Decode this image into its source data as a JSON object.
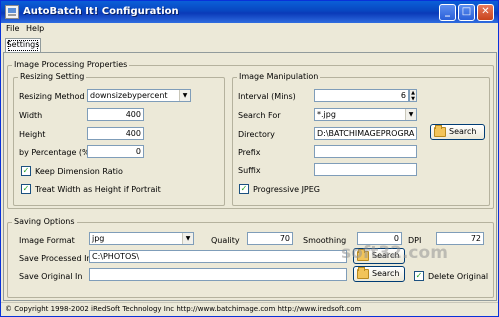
{
  "window": {
    "title": "AutoBatch It! Configuration",
    "minimize": "_",
    "maximize": "□",
    "close": "✕"
  },
  "menu": {
    "file": "File",
    "help": "Help"
  },
  "tab": {
    "settings": "Settings"
  },
  "image_processing": {
    "title": "Image Processing Properties",
    "resizing": {
      "title": "Resizing Setting",
      "method_label": "Resizing Method",
      "method_value": "downsizebypercent",
      "width_label": "Width",
      "width_value": "400",
      "height_label": "Height",
      "height_value": "400",
      "percentage_label": "by Percentage (%)",
      "percentage_value": "0",
      "keep_ratio_label": "Keep Dimension Ratio",
      "keep_ratio_checked": true,
      "treat_width_label": "Treat Width as Height if Portrait",
      "treat_width_checked": true
    },
    "manipulation": {
      "title": "Image Manipulation",
      "interval_label": "Interval (Mins)",
      "interval_value": "6",
      "search_for_label": "Search For",
      "search_for_value": "*.jpg",
      "directory_label": "Directory",
      "directory_value": "D:\\BATCHIMAGEPROGRA",
      "search_button": "Search",
      "prefix_label": "Prefix",
      "prefix_value": "",
      "suffix_label": "Suffix",
      "suffix_value": "",
      "progressive_label": "Progressive JPEG",
      "progressive_checked": true
    }
  },
  "saving": {
    "title": "Saving Options",
    "format_label": "Image Format",
    "format_value": "jpg",
    "quality_label": "Quality",
    "quality_value": "70",
    "smoothing_label": "Smoothing",
    "smoothing_value": "0",
    "dpi_label": "DPI",
    "dpi_value": "72",
    "save_processed_label": "Save Processed In",
    "save_processed_value": "C:\\PHOTOS\\",
    "search_processed_button": "Search",
    "save_original_label": "Save Original In",
    "save_original_value": "",
    "search_original_button": "Search",
    "delete_original_label": "Delete Original",
    "delete_original_checked": true
  },
  "status": {
    "text": "© Copyright 1998-2002 iRedSoft Technology Inc http://www.batchimage.com http://www.iredsoft.com"
  },
  "watermark": {
    "text": "soft32.com"
  },
  "glyphs": {
    "check": "✓",
    "down_arrow": "▼",
    "up_arrow": "▲"
  },
  "icons": {
    "folder": "folder-icon",
    "app": "autobatch-app-icon"
  },
  "colors": {
    "titlebar": "#0a46c0",
    "window_bg": "#ece9d8",
    "close_button": "#c8431c"
  }
}
